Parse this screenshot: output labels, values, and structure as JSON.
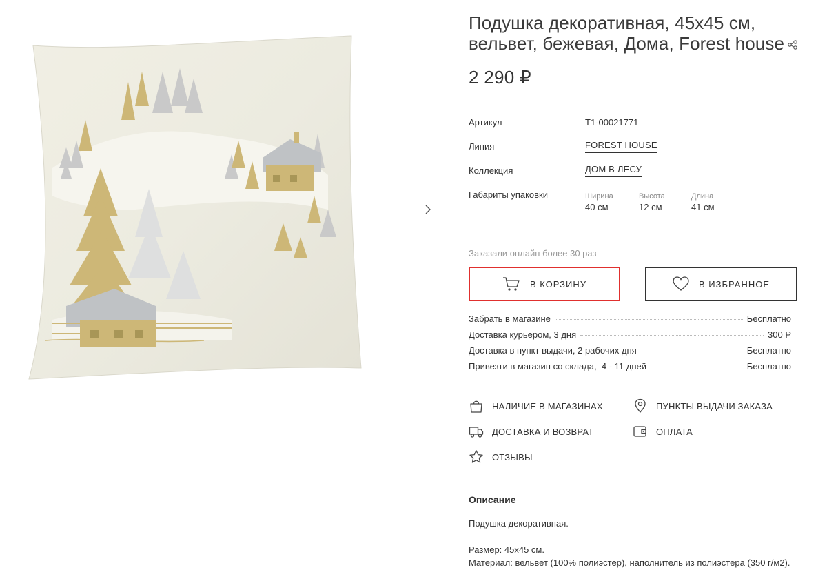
{
  "product": {
    "title": "Подушка декоративная, 45х45 см, вельвет, бежевая, Дома, Forest house",
    "price": "2 290 ₽"
  },
  "gallery": {
    "image_alt": "Декоративная подушка с зимним пейзажем",
    "next_icon": "chevron-right-icon"
  },
  "specs": {
    "article_label": "Артикул",
    "article_value": "Т1-00021771",
    "line_label": "Линия",
    "line_value": "FOREST HOUSE",
    "collection_label": "Коллекция",
    "collection_value": "ДОМ В ЛЕСУ",
    "package_label": "Габариты упаковки",
    "dimensions": [
      {
        "label": "Ширина",
        "value": "40 см"
      },
      {
        "label": "Высота",
        "value": "12 см"
      },
      {
        "label": "Длина",
        "value": "41 см"
      }
    ]
  },
  "ordered_text": "Заказали онлайн более 30 раз",
  "buttons": {
    "cart_label": "В КОРЗИНУ",
    "favorite_label": "В ИЗБРАННОЕ",
    "cart_border_color": "#e0302e"
  },
  "delivery": [
    {
      "label": "Забрать в магазине",
      "value": "Бесплатно"
    },
    {
      "label": "Доставка курьером, 3 дня",
      "value": "300 Р"
    },
    {
      "label": "Доставка в пункт выдачи, 2 рабочих дня",
      "value": "Бесплатно"
    },
    {
      "label": "Привезти в магазин со склада,  4 - 11 дней",
      "value": "Бесплатно"
    }
  ],
  "links": {
    "stores": "НАЛИЧИЕ В МАГАЗИНАХ",
    "pickup_points": "ПУНКТЫ ВЫДАЧИ ЗАКАЗА",
    "delivery_return": "ДОСТАВКА И ВОЗВРАТ",
    "payment": "ОПЛАТА",
    "reviews": "ОТЗЫВЫ"
  },
  "description": {
    "title": "Описание",
    "line1": "Подушка декоративная.",
    "line2": "Размер: 45х45 см.",
    "line3": "Материал: вельвет (100% полиэстер), наполнитель из полиэстера (350 г/м2)."
  }
}
